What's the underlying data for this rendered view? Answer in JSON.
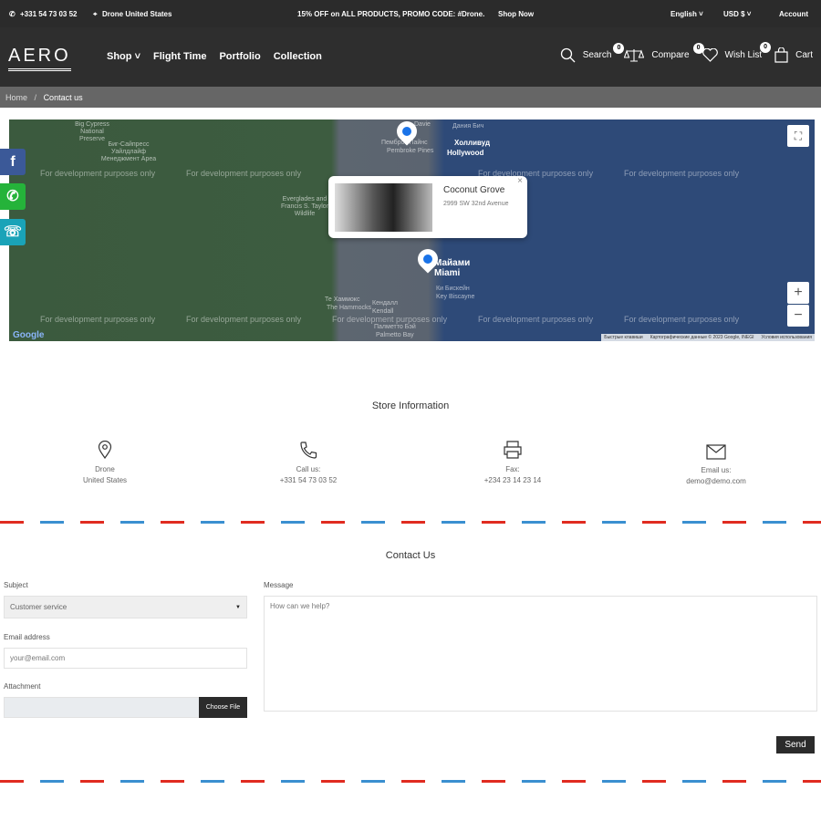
{
  "topbar": {
    "phone": "+331 54 73 03 52",
    "location": "Drone United States",
    "promo": "15% OFF on ALL PRODUCTS, PROMO CODE: #Drone.",
    "shop_now": "Shop Now",
    "language": "English",
    "currency": "USD $",
    "account": "Account"
  },
  "header": {
    "logo": "AERO",
    "nav": [
      "Shop",
      "Flight Time",
      "Portfolio",
      "Collection"
    ],
    "search": "Search",
    "compare": "Compare",
    "wishlist": "Wish List",
    "cart": "Cart",
    "compare_count": "0",
    "wishlist_count": "0",
    "cart_count": "0"
  },
  "breadcrumb": {
    "home": "Home",
    "current": "Contact us"
  },
  "map": {
    "watermark": "For development purposes only",
    "popup_title": "Coconut Grove",
    "popup_address": "2999 SW 32nd Avenue",
    "popup_close": "×",
    "attribution": [
      "Быстрые клавиши",
      "Картографические данные © 2023 Google, INEGI",
      "Условия использования"
    ],
    "logo": "Google",
    "labels": [
      "Davie",
      "Дания Бич",
      "Холливуд",
      "Hollywood",
      "Пемброк Пайнс",
      "Pembroke Pines",
      "Биг-Сайпресс Уайлдлайф Менеджмент Ареа",
      "Everglades and Francis S. Taylor Wildlife",
      "Майами",
      "Miami",
      "Ки Бискейн",
      "Key Biscayne",
      "Те Хаммокс",
      "The Hammocks",
      "Кендалл",
      "Kendall",
      "Палметто Бэй",
      "Palmetto Bay",
      "Big Cypress National Preserve"
    ]
  },
  "store": {
    "title": "Store Information",
    "items": [
      {
        "l1": "Drone",
        "l2": "United States"
      },
      {
        "l1": "Call us:",
        "l2": "+331 54 73 03 52"
      },
      {
        "l1": "Fax:",
        "l2": "+234 23 14 23 14"
      },
      {
        "l1": "Email us:",
        "l2": "demo@demo.com"
      }
    ]
  },
  "contact": {
    "title": "Contact Us",
    "subject_label": "Subject",
    "subject_value": "Customer service",
    "email_label": "Email address",
    "email_placeholder": "your@email.com",
    "attachment_label": "Attachment",
    "choose_file": "Choose File",
    "message_label": "Message",
    "message_placeholder": "How can we help?",
    "send": "Send"
  },
  "colors": {
    "dark": "#2b2b2b",
    "facebook": "#3b5998",
    "whatsapp": "#25b33a",
    "phone": "#1aa3b8",
    "dash_red": "#e02b20",
    "dash_blue": "#3a8fd0"
  }
}
